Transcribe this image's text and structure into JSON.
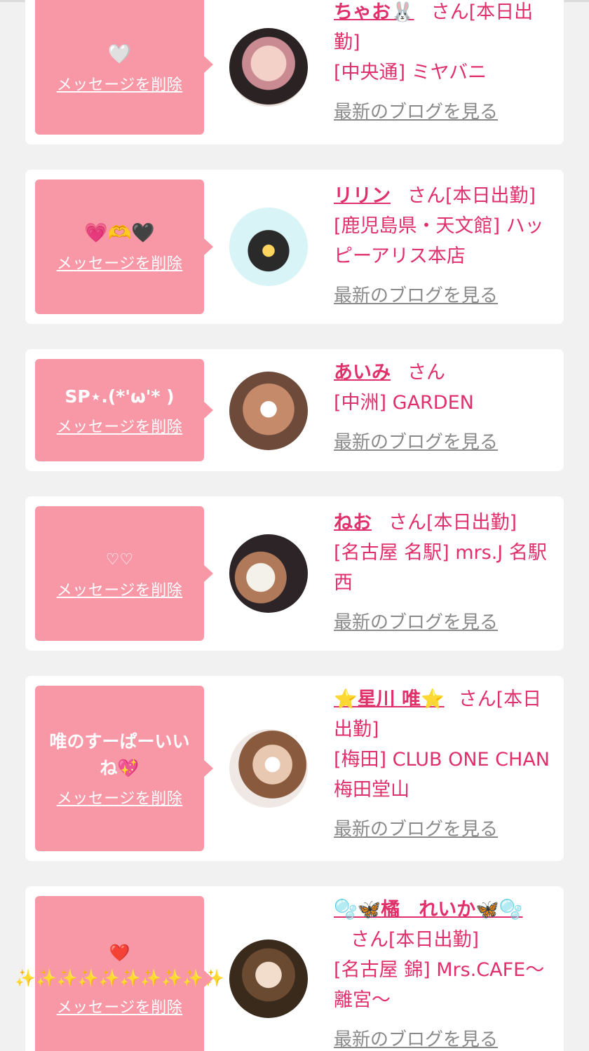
{
  "cards": [
    {
      "message": "🤍",
      "delete_label": "メッセージを削除",
      "name": "ちゃお🐰",
      "san": "さん",
      "status": "[本日出勤]",
      "shop": "[中央通] ミヤバニ",
      "blog_label": "最新のブログを見る"
    },
    {
      "message": "💗🫶🖤",
      "delete_label": "メッセージを削除",
      "name": "リリン",
      "san": "さん",
      "status": "[本日出勤]",
      "shop": "[鹿児島県・天文館] ハッピーアリス本店",
      "blog_label": "最新のブログを見る"
    },
    {
      "message": "SP⋆.(*'ω'* )",
      "delete_label": "メッセージを削除",
      "name": "あいみ",
      "san": "さん",
      "status": "",
      "shop": "[中洲] GARDEN",
      "blog_label": "最新のブログを見る"
    },
    {
      "message": "♡♡",
      "delete_label": "メッセージを削除",
      "name": "ねお",
      "san": "さん",
      "status": "[本日出勤]",
      "shop": "[名古屋 名駅] mrs.J 名駅西",
      "blog_label": "最新のブログを見る"
    },
    {
      "message": "唯のすーぱーいいね💖",
      "delete_label": "メッセージを削除",
      "name": "⭐️星川 唯⭐️",
      "san": "さん",
      "status": "[本日出勤]",
      "shop": "[梅田] CLUB ONE CHAN 梅田堂山",
      "blog_label": "最新のブログを見る"
    },
    {
      "message": "❤️ ✨✨✨✨✨✨✨✨✨✨",
      "delete_label": "メッセージを削除",
      "name": "🫧🦋橘　れいか🦋🫧",
      "san": "さん",
      "status": "[本日出勤]",
      "shop": "[名古屋 錦] Mrs.CAFE〜離宮〜",
      "blog_label": "最新のブログを見る"
    }
  ],
  "colors": {
    "background": "#f1f1f1",
    "card": "#ffffff",
    "bubble": "#f898a6",
    "accent": "#e0306a",
    "link_gray": "#8a8a8a"
  }
}
